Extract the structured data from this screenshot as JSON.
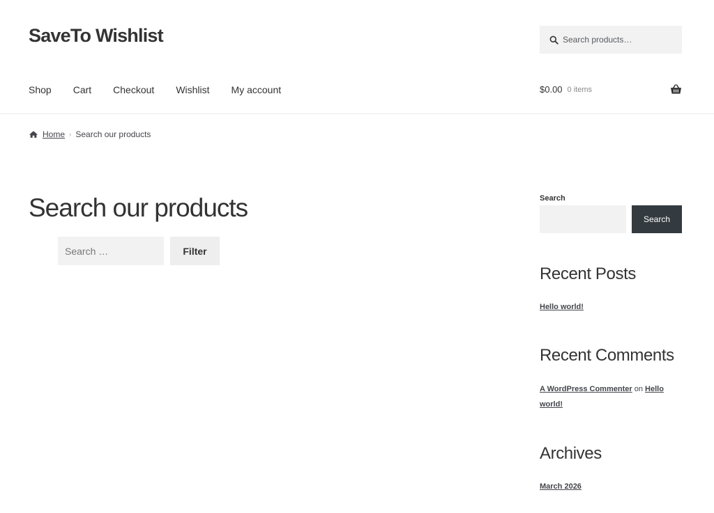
{
  "site": {
    "title": "SaveTo Wishlist"
  },
  "header_search": {
    "placeholder": "Search products…"
  },
  "nav": {
    "items": [
      {
        "label": "Shop",
        "name": "nav-item-shop"
      },
      {
        "label": "Cart",
        "name": "nav-item-cart"
      },
      {
        "label": "Checkout",
        "name": "nav-item-checkout"
      },
      {
        "label": "Wishlist",
        "name": "nav-item-wishlist"
      },
      {
        "label": "My account",
        "name": "nav-item-my-account"
      }
    ]
  },
  "cart": {
    "amount": "$0.00",
    "count": "0 items",
    "icon": "basket-icon"
  },
  "breadcrumb": {
    "home": "Home",
    "current": "Search our products",
    "separator": "›"
  },
  "page": {
    "title": "Search our products"
  },
  "filter_form": {
    "placeholder": "Search …",
    "button": "Filter"
  },
  "sidebar": {
    "search": {
      "label": "Search",
      "button": "Search"
    },
    "recent_posts": {
      "title": "Recent Posts",
      "items": [
        "Hello world!"
      ]
    },
    "recent_comments": {
      "title": "Recent Comments",
      "author": "A WordPress Commenter",
      "connector": "on",
      "post": "Hello world!"
    },
    "archives": {
      "title": "Archives",
      "items": [
        "March 2026"
      ]
    }
  },
  "colors": {
    "text": "#43454b",
    "heading": "#333333",
    "button_dark": "#333a40",
    "field_bg": "#f2f2f2"
  }
}
